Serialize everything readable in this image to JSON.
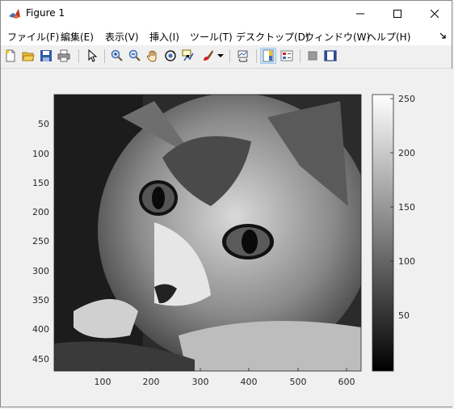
{
  "window": {
    "title": "Figure 1"
  },
  "menu": [
    {
      "label": "ファイル(F)"
    },
    {
      "label": "編集(E)"
    },
    {
      "label": "表示(V)"
    },
    {
      "label": "挿入(I)"
    },
    {
      "label": "ツール(T)"
    },
    {
      "label": "デスクトップ(D)"
    },
    {
      "label": "ウィンドウ(W)"
    },
    {
      "label": "ヘルプ(H)"
    }
  ],
  "toolbar": [
    {
      "name": "new-figure-icon"
    },
    {
      "name": "open-file-icon"
    },
    {
      "name": "save-icon"
    },
    {
      "name": "print-icon"
    },
    {
      "name": "pointer-icon"
    },
    {
      "name": "zoom-in-icon"
    },
    {
      "name": "zoom-out-icon"
    },
    {
      "name": "pan-hand-icon"
    },
    {
      "name": "rotate-3d-icon"
    },
    {
      "name": "data-cursor-icon"
    },
    {
      "name": "brush-icon"
    },
    {
      "name": "link-plot-icon"
    },
    {
      "name": "colorbar-icon"
    },
    {
      "name": "legend-icon"
    },
    {
      "name": "hide-plot-tools-icon"
    },
    {
      "name": "show-plot-tools-icon"
    }
  ],
  "image": {
    "subject": "grayscale cat photo",
    "x_ticks": [
      "100",
      "200",
      "300",
      "400",
      "500",
      "600"
    ],
    "y_ticks": [
      "50",
      "100",
      "150",
      "200",
      "250",
      "300",
      "350",
      "400",
      "450"
    ]
  },
  "colorbar": {
    "ticks": [
      "250",
      "200",
      "150",
      "100",
      "50"
    ]
  },
  "colors": {
    "accent": "#0078d7",
    "axes": "#262626"
  }
}
